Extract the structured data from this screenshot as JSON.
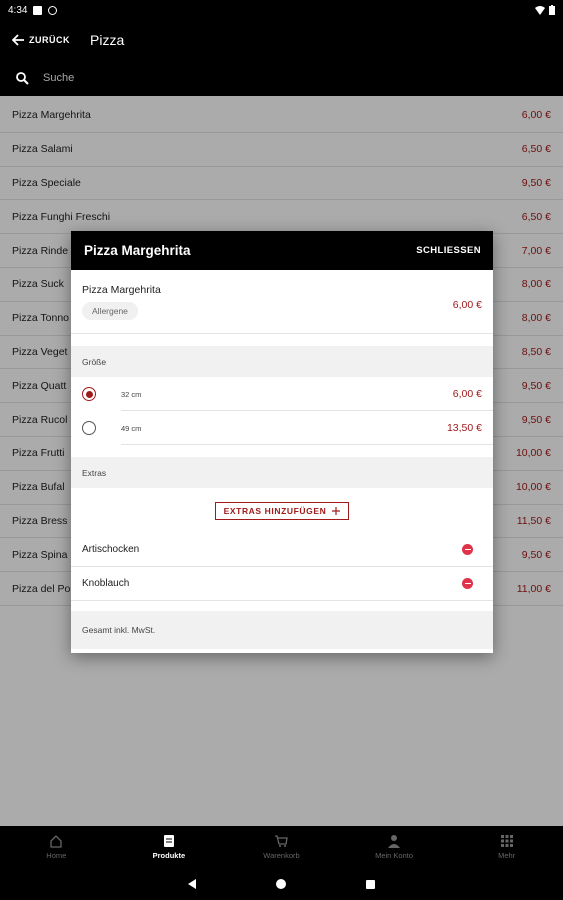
{
  "status_bar": {
    "time": "4:34"
  },
  "app_bar": {
    "back_label": "ZURÜCK",
    "title": "Pizza"
  },
  "search": {
    "placeholder": "Suche"
  },
  "products": [
    {
      "name": "Pizza Margehrita",
      "price": "6,00 €"
    },
    {
      "name": "Pizza Salami",
      "price": "6,50 €"
    },
    {
      "name": "Pizza Speciale",
      "price": "9,50 €"
    },
    {
      "name": "Pizza Funghi Freschi",
      "price": "6,50 €"
    },
    {
      "name": "Pizza Rinde",
      "price": "7,00 €"
    },
    {
      "name": "Pizza Suck",
      "price": "8,00 €"
    },
    {
      "name": "Pizza Tonno",
      "price": "8,00 €"
    },
    {
      "name": "Pizza Veget",
      "price": "8,50 €"
    },
    {
      "name": "Pizza Quatt",
      "price": "9,50 €"
    },
    {
      "name": "Pizza Rucol",
      "price": "9,50 €"
    },
    {
      "name": "Pizza Frutti",
      "price": "10,00 €"
    },
    {
      "name": "Pizza Bufal",
      "price": "10,00 €"
    },
    {
      "name": "Pizza Bress",
      "price": "11,50 €"
    },
    {
      "name": "Pizza Spina",
      "price": "9,50 €"
    },
    {
      "name": "Pizza del Po",
      "price": "11,00 €"
    }
  ],
  "modal": {
    "title": "Pizza Margehrita",
    "close_label": "SCHLIESSEN",
    "product_name": "Pizza Margehrita",
    "allergene_label": "Allergene",
    "product_price": "6,00 €",
    "size_section": "Größe",
    "sizes": [
      {
        "label": "32 cm",
        "price": "6,00 €",
        "selected": true
      },
      {
        "label": "49 cm",
        "price": "13,50 €",
        "selected": false
      }
    ],
    "extras_section": "Extras",
    "extras_button": "EXTRAS HINZUFÜGEN",
    "extras": [
      {
        "name": "Artischocken"
      },
      {
        "name": "Knoblauch"
      }
    ],
    "total_label": "Gesamt inkl. MwSt."
  },
  "bottom_nav": [
    {
      "label": "Home",
      "icon": "home-icon",
      "active": false
    },
    {
      "label": "Produkte",
      "icon": "products-icon",
      "active": true
    },
    {
      "label": "Warenkorb",
      "icon": "cart-icon",
      "active": false
    },
    {
      "label": "Mein Konto",
      "icon": "account-icon",
      "active": false
    },
    {
      "label": "Mehr",
      "icon": "more-grid-icon",
      "active": false
    }
  ],
  "colors": {
    "accent": "#a11a1a",
    "remove": "#e0334a"
  }
}
